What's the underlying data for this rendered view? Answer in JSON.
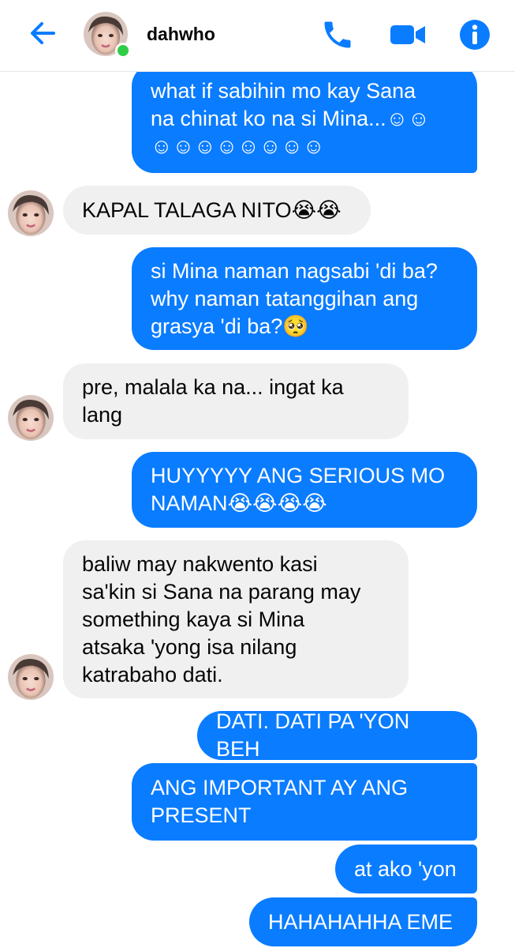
{
  "header": {
    "contact_name": "dahwho",
    "back_icon": "arrow-left-icon",
    "call_icon": "phone-icon",
    "video_icon": "video-camera-icon",
    "info_icon": "info-icon",
    "accent_color": "#0a7cff"
  },
  "messages": [
    {
      "from": "me",
      "text": "what if sabihin mo kay Sana\nna chinat ko na si Mina...☺☺\n☺☺☺☺☺☺☺☺"
    },
    {
      "from": "them",
      "text": "KAPAL TALAGA NITO😭😭"
    },
    {
      "from": "me",
      "text": "si Mina naman nagsabi 'di ba?\nwhy naman tatanggihan ang\ngrasya 'di ba?🥺"
    },
    {
      "from": "them",
      "text": "pre, malala ka na... ingat ka\nlang"
    },
    {
      "from": "me",
      "text": "HUYYYYY ANG SERIOUS MO\nNAMAN😭😭😭😭"
    },
    {
      "from": "them",
      "text": "baliw may nakwento kasi\nsa'kin si Sana na parang may\nsomething kaya si Mina\natsaka 'yong isa nilang\nkatrabaho dati."
    },
    {
      "from": "me",
      "text": "DATI. DATI PA 'YON BEH"
    },
    {
      "from": "me",
      "text": "ANG IMPORTANT AY ANG\nPRESENT"
    },
    {
      "from": "me",
      "text": "at ako 'yon"
    },
    {
      "from": "me",
      "text": "HAHAHAHHA EME"
    }
  ]
}
